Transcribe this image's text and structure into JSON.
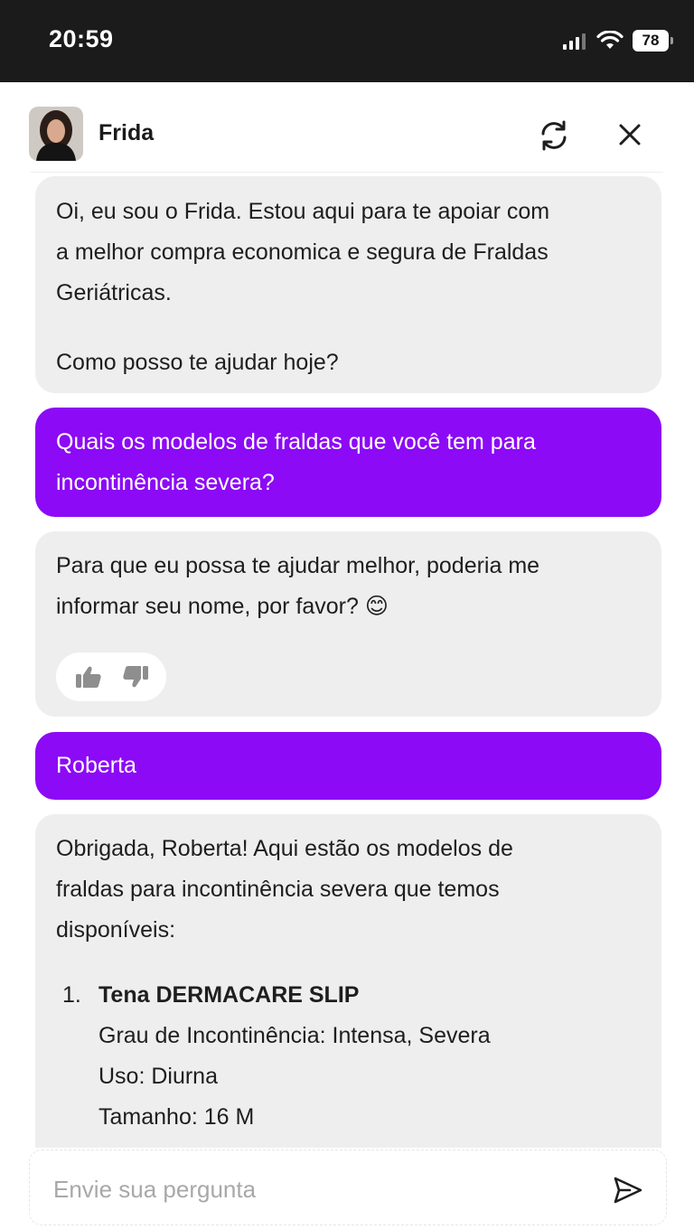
{
  "status_bar": {
    "time": "20:59",
    "battery": "78"
  },
  "header": {
    "agent_name": "Frida"
  },
  "messages": {
    "bot_intro": {
      "line1": "Oi, eu sou o Frida. Estou aqui para te apoiar com",
      "line2": "a melhor compra economica e segura de Fraldas",
      "line3": "Geriátricas.",
      "line4": "Como posso te ajudar hoje?"
    },
    "user_question": {
      "line1": "Quais os modelos de fraldas que você tem para",
      "line2": "incontinência severa?"
    },
    "bot_ask_name": {
      "line1": "Para que eu possa te ajudar melhor, poderia me",
      "line2": "informar seu nome, por favor? 😊"
    },
    "user_name": {
      "text": "Roberta"
    },
    "bot_models": {
      "line1": "Obrigada, Roberta! Aqui estão os modelos de",
      "line2": "fraldas para incontinência severa que temos",
      "line3": "disponíveis:",
      "items": [
        {
          "number": "1.",
          "title": "Tena DERMACARE SLIP",
          "grade": "Grau de Incontinência: Intensa, Severa",
          "use": "Uso: Diurna",
          "size": "Tamanho: 16 M"
        }
      ]
    }
  },
  "input": {
    "placeholder": "Envie sua pergunta"
  },
  "colors": {
    "user_bubble": "#8c0af5",
    "bot_bubble": "#eeeeee",
    "status_bar": "#1b1b1b"
  },
  "icons": [
    "signal-icon",
    "wifi-icon",
    "battery-icon",
    "refresh-icon",
    "close-icon",
    "thumbs-up-icon",
    "thumbs-down-icon",
    "send-icon"
  ]
}
